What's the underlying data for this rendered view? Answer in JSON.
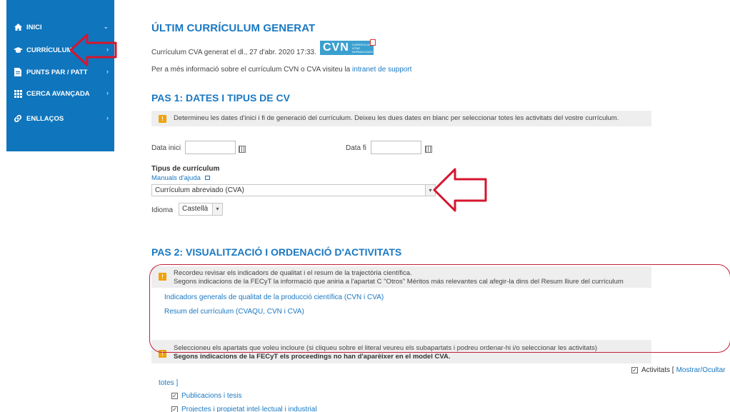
{
  "sidebar": {
    "items": [
      {
        "label": "INICI",
        "icon": "home-icon",
        "chevron": "⌄"
      },
      {
        "label": "CURRÍCULUM",
        "icon": "graduation-cap-icon",
        "chevron": "›"
      },
      {
        "label": "PUNTS PAR / PATT",
        "icon": "document-icon",
        "chevron": "›"
      },
      {
        "label": "CERCA AVANÇADA",
        "icon": "grid-icon",
        "chevron": "›"
      },
      {
        "label": "ENLLAÇOS",
        "icon": "link-icon",
        "chevron": "›"
      }
    ]
  },
  "header": {
    "title": "ÚLTIM CURRÍCULUM GENERAT",
    "generated_text": "Currículum CVA generat el dl., 27 d'abr. 2020 17:33.",
    "badge_text": "CVN",
    "badge_subtext": "CURRÍCULUM VITAE NORMALIZADO",
    "info_prefix": "Per a més informació sobre el currículum CVN o CVA visiteu la",
    "info_link": "intranet de support"
  },
  "step1": {
    "title": "PAS 1: DATES I TIPUS DE CV",
    "notice": "Determineu les dates d'inici i fi de generació del currículum. Deixeu les dues dates en blanc per seleccionar totes les activitats del vostre currículum.",
    "start_label": "Data inici",
    "end_label": "Data fi",
    "start_value": "",
    "end_value": "",
    "cv_type_label": "Tipus de currículum",
    "help_link": "Manuals d'ajuda",
    "cv_type_value": "Currículum abreviado (CVA)",
    "language_label": "Idioma",
    "language_value": "Castellà"
  },
  "step2": {
    "title": "PAS 2: VISUALITZACIÓ I ORDENACIÓ D'ACTIVITATS",
    "notice_line1": "Recordeu revisar els indicadors de qualitat i el resum de la trajectòria científica.",
    "notice_line2": "Segons indicacions de la FECyT la informació que aniria a l'apartat C \"Otros\" Méritos más relevantes cal afegir-la dins del Resum lliure del currículum",
    "link1": "Indicadors generals de qualitat de la producció científica (CVN i CVA)",
    "link2": "Resum del currículum (CVAQU, CVN i CVA)",
    "notice2_line1": "Seleccioneu els apartats que voleu incloure (si cliqueu sobre el literal veureu els subapartats i podreu ordenar-hi i/o seleccionar les activitats)",
    "notice2_line2": "Segons indicacions de la FECyT els proceedings no han d'aparèixer en el model CVA.",
    "activities_label": "Activitats [",
    "show_hide_link": "Mostrar/Ocultar",
    "totes": "totes ]",
    "items": [
      {
        "label": "Publicacions i tesis",
        "checked": true
      },
      {
        "label": "Projectes i propietat intel·lectual i industrial",
        "checked": true
      }
    ]
  }
}
